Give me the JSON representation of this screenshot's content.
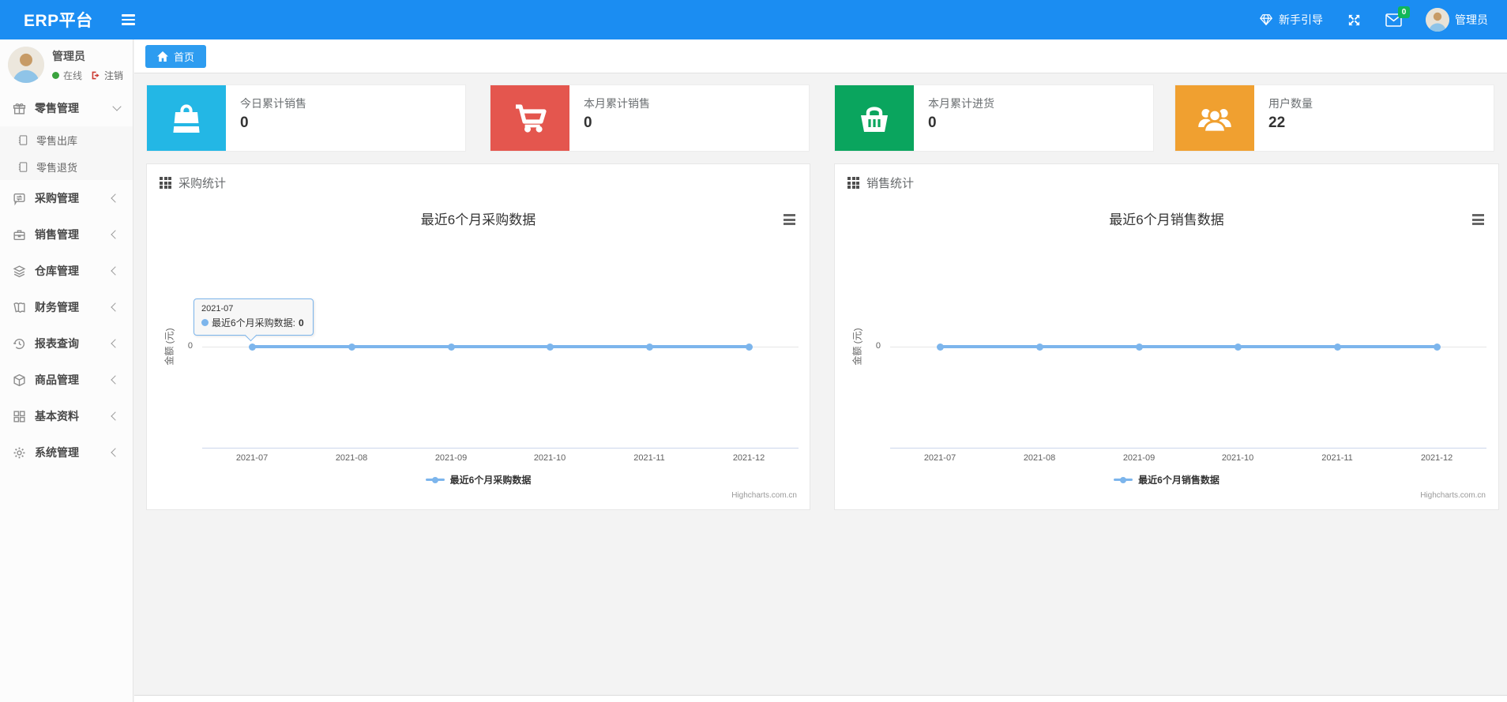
{
  "navbar": {
    "brand": "ERP平台",
    "guide_label": "新手引导",
    "mail_badge": "0",
    "admin_label": "管理员",
    "bg_color": "#1b8df2"
  },
  "sidebar": {
    "user": {
      "name": "管理员",
      "status": "在线",
      "logout_label": "注销"
    },
    "menu": [
      {
        "label": "零售管理",
        "icon": "gift-icon",
        "expanded": true,
        "children": [
          {
            "label": "零售出库",
            "icon": "journal-icon"
          },
          {
            "label": "零售退货",
            "icon": "journal-icon"
          }
        ]
      },
      {
        "label": "采购管理",
        "icon": "exchange-icon"
      },
      {
        "label": "销售管理",
        "icon": "briefcase-icon"
      },
      {
        "label": "仓库管理",
        "icon": "layers-icon"
      },
      {
        "label": "财务管理",
        "icon": "ledger-icon"
      },
      {
        "label": "报表查询",
        "icon": "history-icon"
      },
      {
        "label": "商品管理",
        "icon": "package-icon"
      },
      {
        "label": "基本资料",
        "icon": "grid-icon"
      },
      {
        "label": "系统管理",
        "icon": "gear-icon"
      }
    ]
  },
  "tabs": {
    "home": "首页"
  },
  "stats": [
    {
      "label": "今日累计销售",
      "value": "0",
      "color": "#23b7e5",
      "icon": "shopping-bag-icon"
    },
    {
      "label": "本月累计销售",
      "value": "0",
      "color": "#e4564e",
      "icon": "shopping-cart-icon"
    },
    {
      "label": "本月累计进货",
      "value": "0",
      "color": "#0aa55e",
      "icon": "shopping-basket-icon"
    },
    {
      "label": "用户数量",
      "value": "22",
      "color": "#f0a030",
      "icon": "users-icon"
    }
  ],
  "panels": [
    {
      "title": "采购统计"
    },
    {
      "title": "销售统计"
    }
  ],
  "chart_data": [
    {
      "type": "line",
      "title": "最近6个月采购数据",
      "categories": [
        "2021-07",
        "2021-08",
        "2021-09",
        "2021-10",
        "2021-11",
        "2021-12"
      ],
      "series": [
        {
          "name": "最近6个月采购数据",
          "values": [
            0,
            0,
            0,
            0,
            0,
            0
          ]
        }
      ],
      "xlabel": "",
      "ylabel": "金额 (元)",
      "yticks": [
        "0"
      ],
      "ylim": [
        0,
        0
      ],
      "grid": "zero-line-only",
      "legend_position": "bottom",
      "line_color": "#7cb5ec",
      "credit": "Highcharts.com.cn",
      "tooltip": {
        "category": "2021-07",
        "label": "最近6个月采购数据:",
        "value": "0"
      }
    },
    {
      "type": "line",
      "title": "最近6个月销售数据",
      "categories": [
        "2021-07",
        "2021-08",
        "2021-09",
        "2021-10",
        "2021-11",
        "2021-12"
      ],
      "series": [
        {
          "name": "最近6个月销售数据",
          "values": [
            0,
            0,
            0,
            0,
            0,
            0
          ]
        }
      ],
      "xlabel": "",
      "ylabel": "金额 (元)",
      "yticks": [
        "0"
      ],
      "ylim": [
        0,
        0
      ],
      "grid": "zero-line-only",
      "legend_position": "bottom",
      "line_color": "#7cb5ec",
      "credit": "Highcharts.com.cn"
    }
  ]
}
